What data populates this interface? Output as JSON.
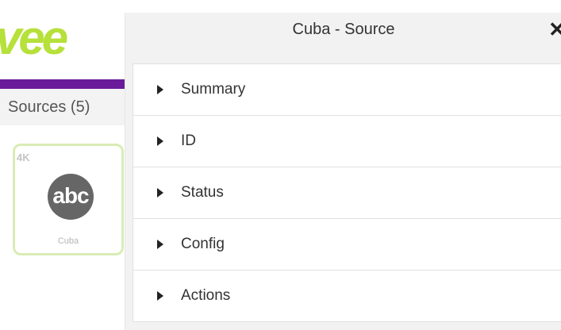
{
  "app": {
    "logo_text": "vee",
    "sources_title": "Sources (5)",
    "source_card": {
      "badge": "4K",
      "logo_text": "abc",
      "label": "Cuba"
    },
    "colors": {
      "brand": "#b6e03a",
      "purple": "#6a1b9a",
      "card_border": "#d9ecb5"
    }
  },
  "modal": {
    "title": "Cuba - Source",
    "close_label": "✕",
    "sections": [
      {
        "label": "Summary"
      },
      {
        "label": "ID"
      },
      {
        "label": "Status"
      },
      {
        "label": "Config"
      },
      {
        "label": "Actions"
      }
    ]
  }
}
